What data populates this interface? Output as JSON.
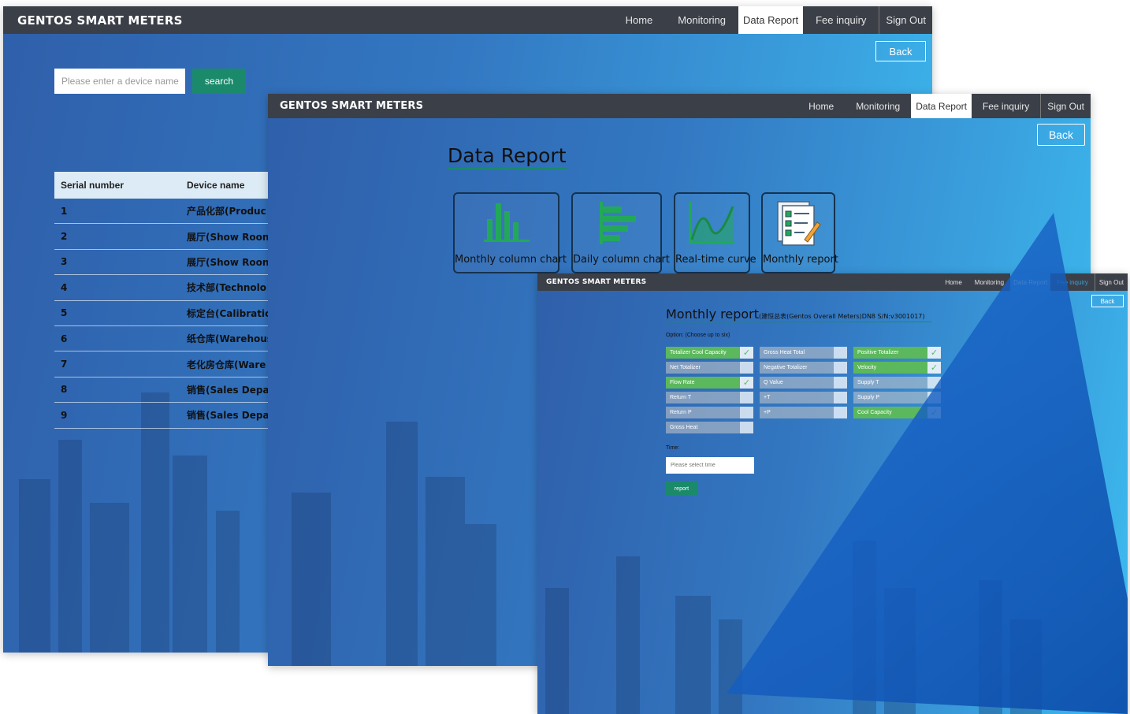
{
  "brand": "GENTOS SMART METERS",
  "nav": [
    {
      "label": "Home"
    },
    {
      "label": "Monitoring"
    },
    {
      "label": "Data Report"
    },
    {
      "label": "Fee inquiry"
    },
    {
      "label": "Sign Out"
    }
  ],
  "back_label": "Back",
  "device_list": {
    "search_placeholder": "Please enter a device name",
    "search_label": "search",
    "columns": [
      "Serial number",
      "Device name"
    ],
    "rows": [
      {
        "serial": "1",
        "name": "产品化部(Produc"
      },
      {
        "serial": "2",
        "name": "展厅(Show Roon"
      },
      {
        "serial": "3",
        "name": "展厅(Show Roon"
      },
      {
        "serial": "4",
        "name": "技术部(Technolo"
      },
      {
        "serial": "5",
        "name": "标定台(Calibratic"
      },
      {
        "serial": "6",
        "name": "纸仓库(Warehous"
      },
      {
        "serial": "7",
        "name": "老化房仓库(Ware"
      },
      {
        "serial": "8",
        "name": "销售(Sales Depai"
      },
      {
        "serial": "9",
        "name": "销售(Sales Depai"
      }
    ]
  },
  "data_report": {
    "title": "Data Report",
    "tiles": [
      {
        "label": "Monthly column chart",
        "icon": "column-chart-icon"
      },
      {
        "label": "Daily column chart",
        "icon": "bar-chart-icon"
      },
      {
        "label": "Real-time curve",
        "icon": "curve-chart-icon"
      },
      {
        "label": "Monthly report",
        "icon": "report-checklist-icon"
      }
    ]
  },
  "monthly_report": {
    "title": "Monthly report",
    "subtitle": "(建恒总表(Gentos Overall Meters)DN8  S/N:v3001017)",
    "option_label": "Option:    (Choose up to six)",
    "options": [
      [
        {
          "label": "Totalizer Cool Capacity",
          "checked": true
        },
        {
          "label": "Net Totalizer",
          "checked": false
        },
        {
          "label": "Flow Rate",
          "checked": true
        },
        {
          "label": "Return T",
          "checked": false
        },
        {
          "label": "Return P",
          "checked": false
        },
        {
          "label": "Gross Heat",
          "checked": false
        }
      ],
      [
        {
          "label": "Gross Heat Total",
          "checked": false
        },
        {
          "label": "Negative Totalizer",
          "checked": false
        },
        {
          "label": "Q Value",
          "checked": false
        },
        {
          "label": "+T",
          "checked": false
        },
        {
          "label": "+P",
          "checked": false
        }
      ],
      [
        {
          "label": "Positive Totalizer",
          "checked": true
        },
        {
          "label": "Velocity",
          "checked": true
        },
        {
          "label": "Supply T",
          "checked": false
        },
        {
          "label": "Supply P",
          "checked": false
        },
        {
          "label": "Cool Capacity",
          "checked": true
        }
      ]
    ],
    "time_label": "Time:",
    "time_placeholder": "Please select time",
    "report_label": "report"
  },
  "colors": {
    "topbar": "#3b3f48",
    "accent_green": "#1b8a6b",
    "checked_green": "#5cb85c",
    "bg_blue_start": "#2f5faa",
    "bg_blue_end": "#3cbdf0"
  }
}
